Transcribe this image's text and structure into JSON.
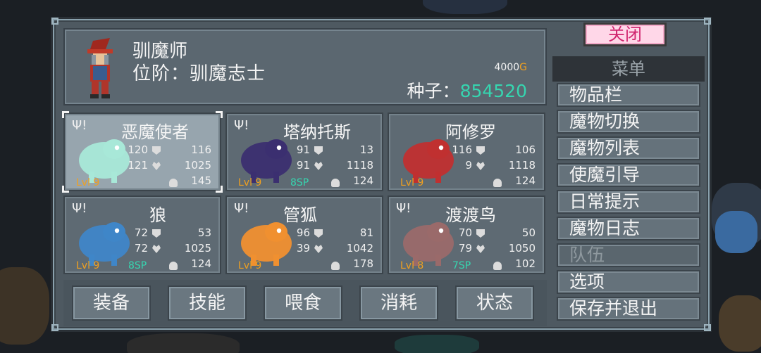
{
  "header": {
    "name": "驯魔师",
    "rank": "位阶：驯魔志士",
    "gold_amount": "4000",
    "gold_unit": "G",
    "seed_label": "种子：",
    "seed_value": "854520"
  },
  "monsters": [
    {
      "name": "恶魔使者",
      "stat1": "120",
      "stat2": "116",
      "stat3": "121",
      "stat4": "1025",
      "stat5": "145",
      "level": "Lvl 9",
      "sp": "",
      "fork": "Ψ!",
      "color": "#a8e8d8"
    },
    {
      "name": "塔纳托斯",
      "stat1": "91",
      "stat2": "13",
      "stat3": "91",
      "stat4": "1118",
      "stat5": "124",
      "level": "Lvl 9",
      "sp": "8SP",
      "fork": "Ψ!",
      "color": "#3b2f70"
    },
    {
      "name": "阿修罗",
      "stat1": "116",
      "stat2": "106",
      "stat3": "9",
      "stat4": "1118",
      "stat5": "124",
      "level": "Lvl 9",
      "sp": "",
      "fork": "",
      "color": "#c03030"
    },
    {
      "name": "狼",
      "stat1": "72",
      "stat2": "53",
      "stat3": "72",
      "stat4": "1025",
      "stat5": "124",
      "level": "Lvl 9",
      "sp": "8SP",
      "fork": "Ψ!",
      "color": "#3f86c8"
    },
    {
      "name": "管狐",
      "stat1": "96",
      "stat2": "81",
      "stat3": "39",
      "stat4": "1042",
      "stat5": "178",
      "level": "Lvl 9",
      "sp": "",
      "fork": "Ψ!",
      "color": "#f09030"
    },
    {
      "name": "渡渡鸟",
      "stat1": "70",
      "stat2": "50",
      "stat3": "79",
      "stat4": "1050",
      "stat5": "102",
      "level": "Lvl 8",
      "sp": "7SP",
      "fork": "Ψ!",
      "color": "#9a6a6a"
    }
  ],
  "bottom_buttons": [
    "装备",
    "技能",
    "喂食",
    "消耗",
    "状态"
  ],
  "menu": {
    "close_label": "关闭",
    "title": "菜单",
    "items": [
      "物品栏",
      "魔物切换",
      "魔物列表",
      "使魔引导",
      "日常提示",
      "魔物日志",
      "队伍",
      "选项",
      "保存并退出"
    ]
  }
}
